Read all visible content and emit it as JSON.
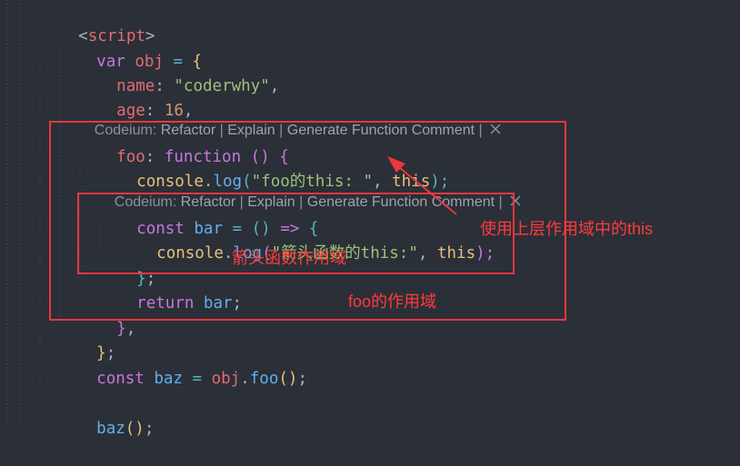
{
  "code": {
    "l1": {
      "open": "<",
      "tag": "script",
      "close": ">"
    },
    "l2": {
      "kw": "var",
      "name": "obj",
      "eq": " = ",
      "brace": "{"
    },
    "l3": {
      "prop": "name",
      "colon": ": ",
      "str": "\"coderwhy\"",
      "comma": ","
    },
    "l4": {
      "prop": "age",
      "colon": ": ",
      "num": "16",
      "comma": ","
    },
    "l5": {
      "prop": "foo",
      "colon": ": ",
      "kw": "function",
      "parens": " () ",
      "brace": "{"
    },
    "l6": {
      "obj": "console",
      "dot": ".",
      "fn": "log",
      "open": "(",
      "str": "\"foo的this: \"",
      "comma": ", ",
      "this": "this",
      "close": ");"
    },
    "l7": {
      "kw": "const",
      "name": "bar",
      "eq": " = ",
      "parens": "()",
      "arrow": " => ",
      "brace": "{"
    },
    "l8": {
      "obj": "console",
      "dot": ".",
      "fn": "log",
      "open": "(",
      "str": "\"箭头函数的this:\"",
      "comma": ", ",
      "this": "this",
      "close": ");"
    },
    "l9": {
      "brace": "}",
      "semi": ";"
    },
    "l10": {
      "kw": "return",
      "name": "bar",
      "semi": ";"
    },
    "l11": {
      "brace": "}",
      "comma": ","
    },
    "l12": {
      "brace": "}",
      "semi": ";"
    },
    "l13": {
      "kw": "const",
      "name": "baz",
      "eq": " = ",
      "obj": "obj",
      "dot": ".",
      "fn": "foo",
      "call": "()",
      "semi": ";"
    },
    "l15": {
      "fn": "baz",
      "call": "()",
      "semi": ";"
    }
  },
  "codelens": {
    "prefix": "Codeium: ",
    "refactor": "Refactor",
    "sep": " | ",
    "explain": "Explain",
    "generate": "Generate Function Comment"
  },
  "annotations": {
    "this_note": "使用上层作用域中的this",
    "arrow_scope": "箭头函数作用域",
    "foo_scope": "foo的作用域"
  },
  "colors": {
    "background": "#2b2f37",
    "annotation": "#e8383d",
    "keyword": "#c678dd",
    "property": "#e06c75",
    "string": "#98c379"
  }
}
